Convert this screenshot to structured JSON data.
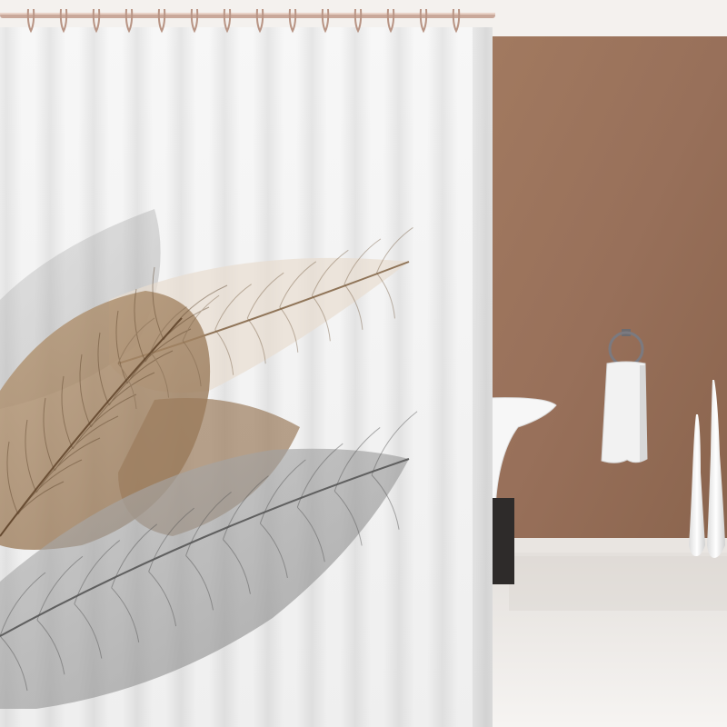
{
  "scene": {
    "subject": "shower-curtain",
    "colors": {
      "ceiling": "#f4f1ee",
      "wall": "#9a7157",
      "wall_dark": "#855f48",
      "floor": "#ece9e6",
      "curtain": "#f3f3f3",
      "curtain_shadow": "#d9d9d9",
      "leaf_tan": "#a88a6a",
      "leaf_gray": "#8c8c8c",
      "rod": "#c9a89a",
      "towel": "#f2f2f2",
      "tub": "#f6f6f6",
      "cabinet": "#2e2b2a",
      "vase": "#fafafa"
    },
    "rings": 14,
    "vases": 2
  }
}
